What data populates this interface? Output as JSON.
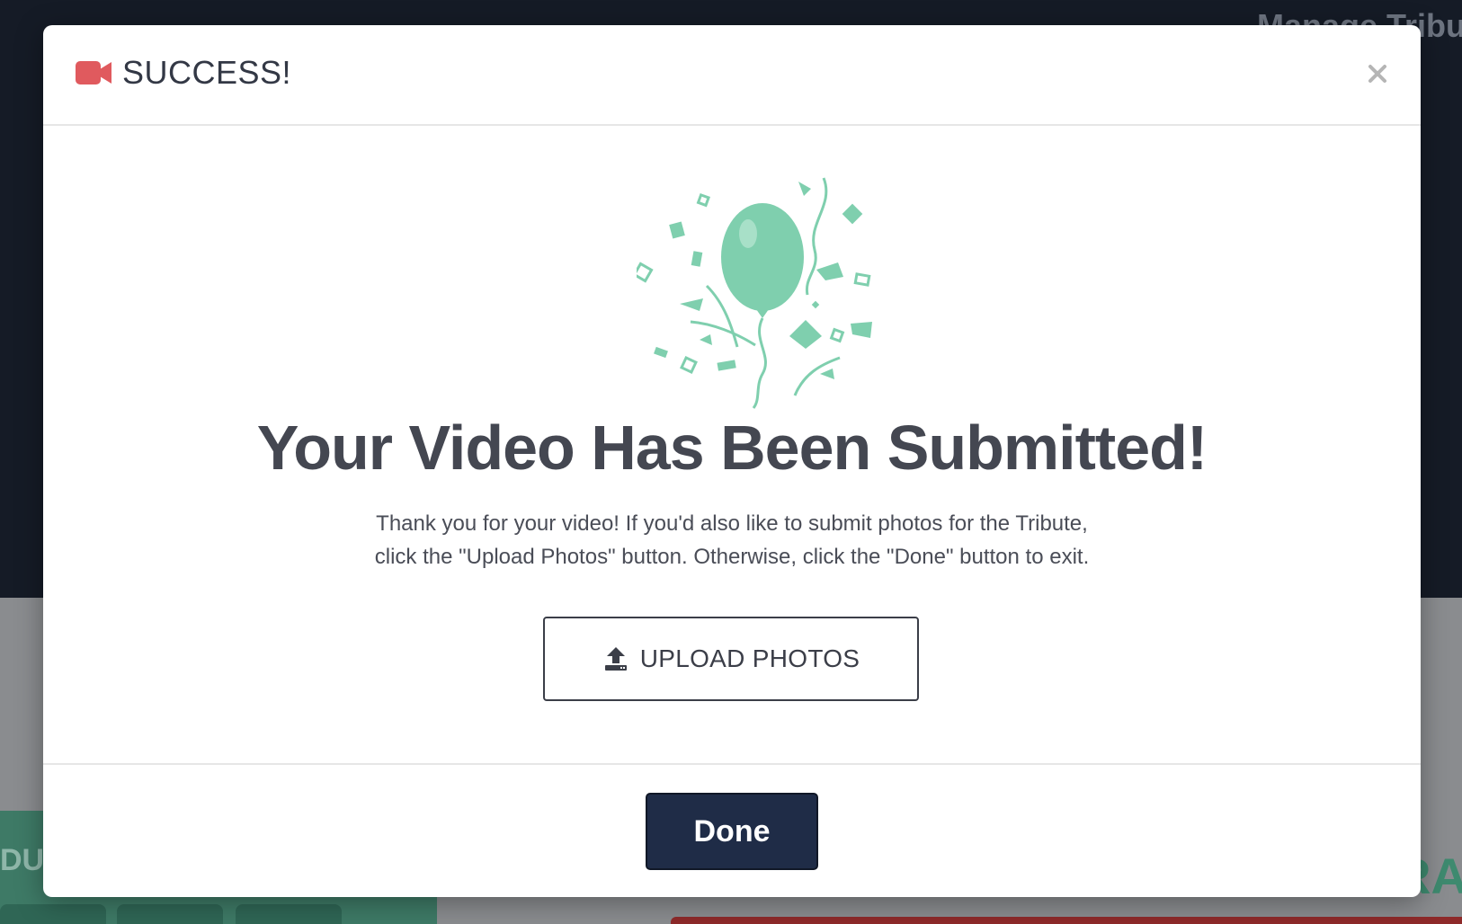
{
  "background": {
    "top_right_text": "Manage Tribu",
    "left_text": "DU",
    "right_text": "RA"
  },
  "modal": {
    "header": {
      "title": "SUCCESS!",
      "icon": "video-camera-icon",
      "close_icon": "close-icon"
    },
    "illustration": "balloon-confetti-illustration",
    "title": "Your Video Has Been Submitted!",
    "description_line1": "Thank you for your video! If you'd also like to submit photos for the Tribute,",
    "description_line2": "click the \"Upload Photos\" button. Otherwise, click the \"Done\" button to exit.",
    "upload_button": {
      "label": "UPLOAD PHOTOS",
      "icon": "upload-icon"
    },
    "done_button": {
      "label": "Done"
    }
  },
  "colors": {
    "accent_red": "#e05a5e",
    "illustration_green": "#7fcfae",
    "done_navy": "#1f2c47",
    "text_dark": "#444751"
  }
}
